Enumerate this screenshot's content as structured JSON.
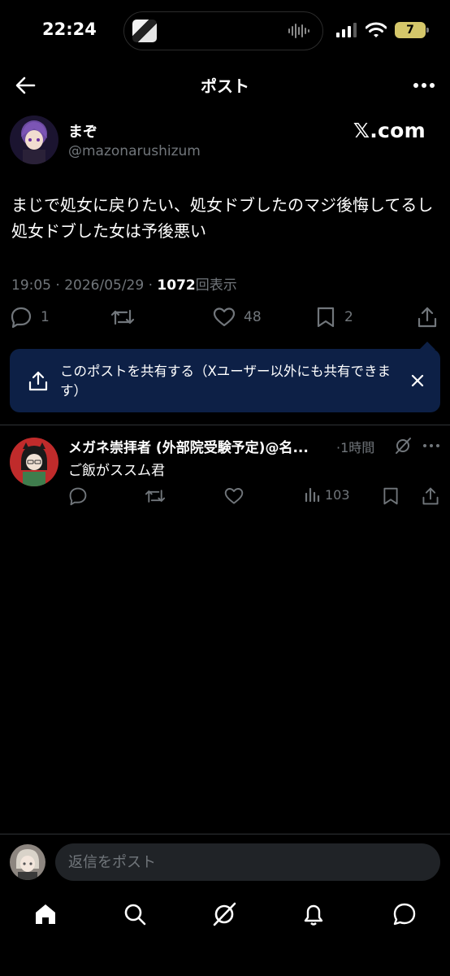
{
  "status_bar": {
    "time": "22:24",
    "battery": "7"
  },
  "header": {
    "title": "ポスト"
  },
  "post": {
    "author_name": "まぞ",
    "handle": "@mazonarushizum",
    "source": "𝕏.com",
    "text": "まじで処女に戻りたい、処女ドブしたのマジ後悔してるし処女ドブした女は予後悪い",
    "time": "19:05 · 2026/05/29 · ",
    "views_count": "1072",
    "views_label": "回表示",
    "replies": "1",
    "likes": "48",
    "bookmarks": "2"
  },
  "share_tooltip": {
    "text": "このポストを共有する（Xユーザー以外にも共有できます）"
  },
  "reply": {
    "author_name": "メガネ崇拝者 (外部院受験予定)@名...",
    "time": "·1時間",
    "text": "ご飯がススム君",
    "views": "103"
  },
  "reply_bar": {
    "placeholder": "返信をポスト"
  },
  "colors": {
    "background": "#000000",
    "muted": "#71767b",
    "tooltip": "#0d2046",
    "battery": "#d5c76a"
  },
  "icons": [
    "back-arrow-icon",
    "more-icon",
    "reply-icon",
    "repost-icon",
    "like-icon",
    "bookmark-icon",
    "share-icon",
    "close-icon",
    "grok-icon",
    "views-icon",
    "home-icon",
    "search-icon",
    "notifications-icon",
    "messages-icon"
  ]
}
